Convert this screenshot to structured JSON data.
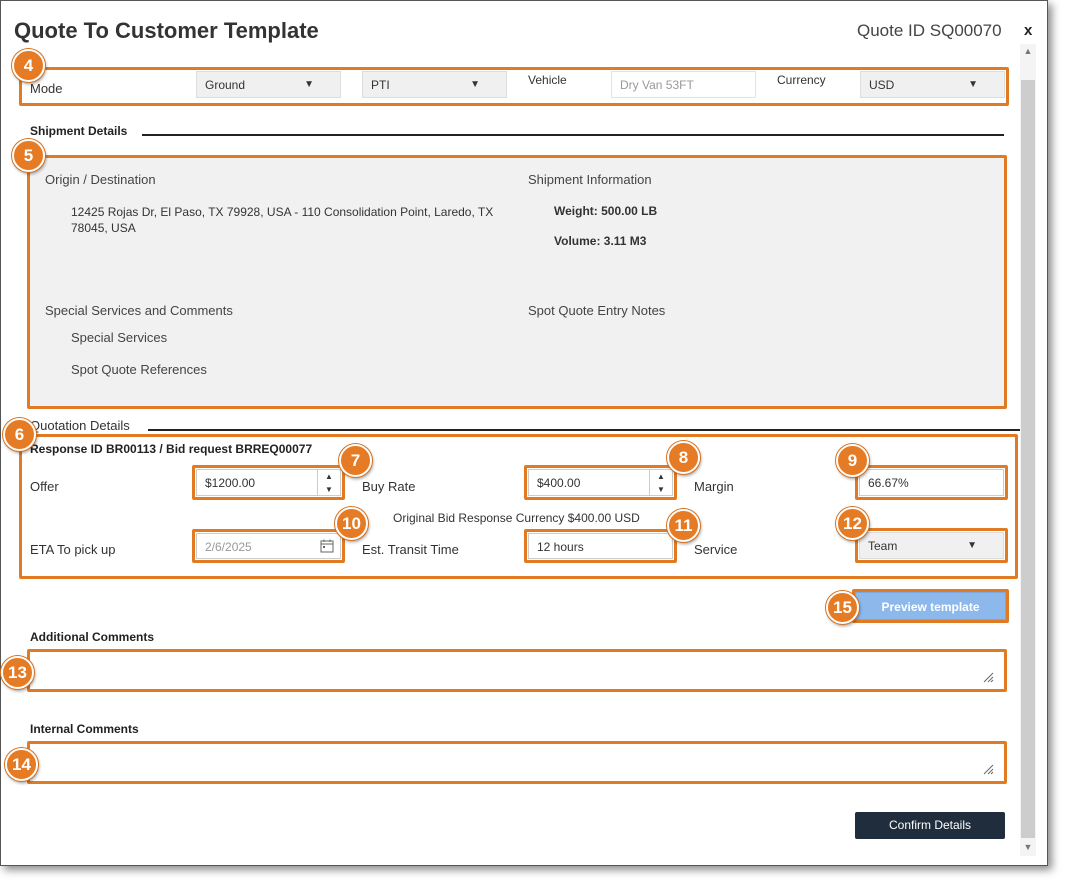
{
  "dialog": {
    "title": "Quote To Customer Template",
    "quote_id": "Quote ID SQ00070",
    "close_label": "x"
  },
  "badges": [
    "4",
    "5",
    "6",
    "7",
    "8",
    "9",
    "10",
    "11",
    "12",
    "13",
    "14",
    "15"
  ],
  "mode_row": {
    "mode_label": "Mode",
    "mode_value": "Ground",
    "sub_mode_value": "PTI",
    "vehicle_label": "Vehicle",
    "vehicle_placeholder": "Dry Van 53FT",
    "currency_label": "Currency",
    "currency_value": "USD"
  },
  "shipment": {
    "section_title": "Shipment Details",
    "origin_heading": "Origin / Destination",
    "origin_text": "12425 Rojas Dr, El Paso, TX 79928, USA - 110 Consolidation Point, Laredo, TX 78045, USA",
    "info_heading": "Shipment Information",
    "weight": "Weight: 500.00 LB",
    "volume": "Volume: 3.11 M3",
    "special_heading": "Special Services and Comments",
    "special_services": "Special Services",
    "spot_quote_refs": "Spot Quote References",
    "spot_notes_heading": "Spot Quote Entry Notes"
  },
  "quotation": {
    "section_title": "Quotation Details",
    "response_id": "Response ID BR00113 / Bid request BRREQ00077",
    "offer_label": "Offer",
    "offer_value": "$1200.00",
    "buy_rate_label": "Buy Rate",
    "buy_rate_value": "$400.00",
    "margin_label": "Margin",
    "margin_value": "66.67%",
    "original_bid": "Original Bid Response Currency $400.00 USD",
    "eta_label": "ETA To pick up",
    "eta_value": "2/6/2025",
    "transit_label": "Est. Transit Time",
    "transit_value": "12 hours",
    "service_label": "Service",
    "service_value": "Team"
  },
  "actions": {
    "preview_label": "Preview template",
    "confirm_label": "Confirm Details"
  },
  "comments": {
    "additional_label": "Additional Comments",
    "internal_label": "Internal Comments"
  },
  "colors": {
    "annotation_orange": "#e07b24",
    "preview_button": "#8db8ec",
    "confirm_button": "#1f2d3d"
  }
}
